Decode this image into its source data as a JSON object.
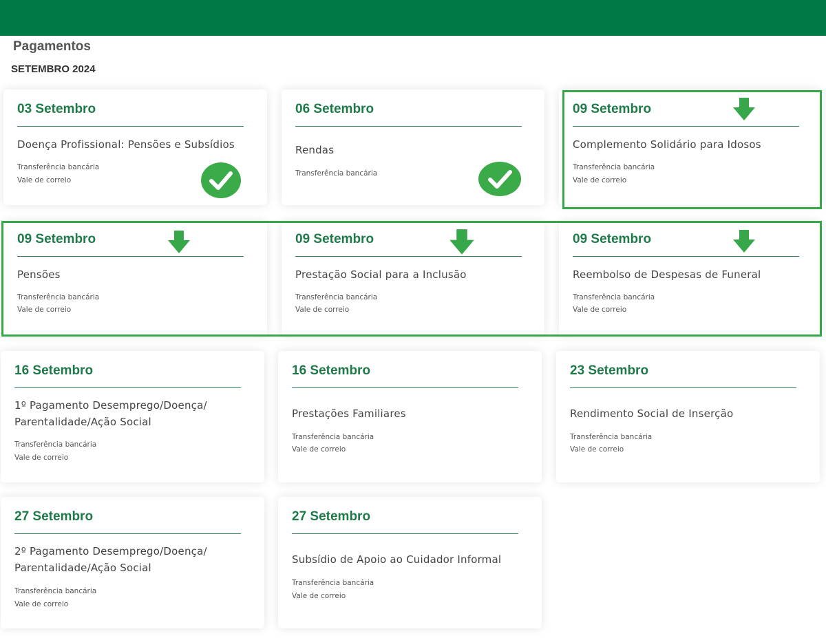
{
  "header": {
    "title": "Pagamentos",
    "month": "SETEMBRO 2024"
  },
  "methods": {
    "bank": "Transferência bancária",
    "postal": "Vale de correio"
  },
  "colors": {
    "brand_green": "#007a45",
    "date_green": "#1f7a49",
    "highlight_green": "#36a84a"
  },
  "cards": [
    {
      "date": "03 Setembro",
      "benefit": "Doença Profissional: Pensões e Subsídios",
      "status": "paid"
    },
    {
      "date": "06 Setembro",
      "benefit": "Rendas",
      "status": "paid"
    },
    {
      "date": "09 Setembro",
      "benefit": "Complemento Solidário para Idosos",
      "status": "highlighted"
    },
    {
      "date": "09 Setembro",
      "benefit": "Pensões",
      "status": "highlighted"
    },
    {
      "date": "09 Setembro",
      "benefit": "Prestação Social para a Inclusão",
      "status": "highlighted"
    },
    {
      "date": "09 Setembro",
      "benefit": "Reembolso de Despesas de Funeral",
      "status": "highlighted"
    },
    {
      "date": "16 Setembro",
      "benefit_lines": [
        "1º Pagamento Desemprego/Doença/",
        "Parentalidade/Ação Social"
      ]
    },
    {
      "date": "16 Setembro",
      "benefit": "Prestações Familiares"
    },
    {
      "date": "23 Setembro",
      "benefit": "Rendimento Social de Inserção"
    },
    {
      "date": "27 Setembro",
      "benefit_lines": [
        "2º Pagamento Desemprego/Doença/",
        "Parentalidade/Ação Social"
      ]
    },
    {
      "date": "27 Setembro",
      "benefit": "Subsídio de Apoio ao Cuidador Informal"
    }
  ],
  "icons": {
    "paid": "check-circle-icon",
    "highlight": "arrow-down-icon"
  }
}
